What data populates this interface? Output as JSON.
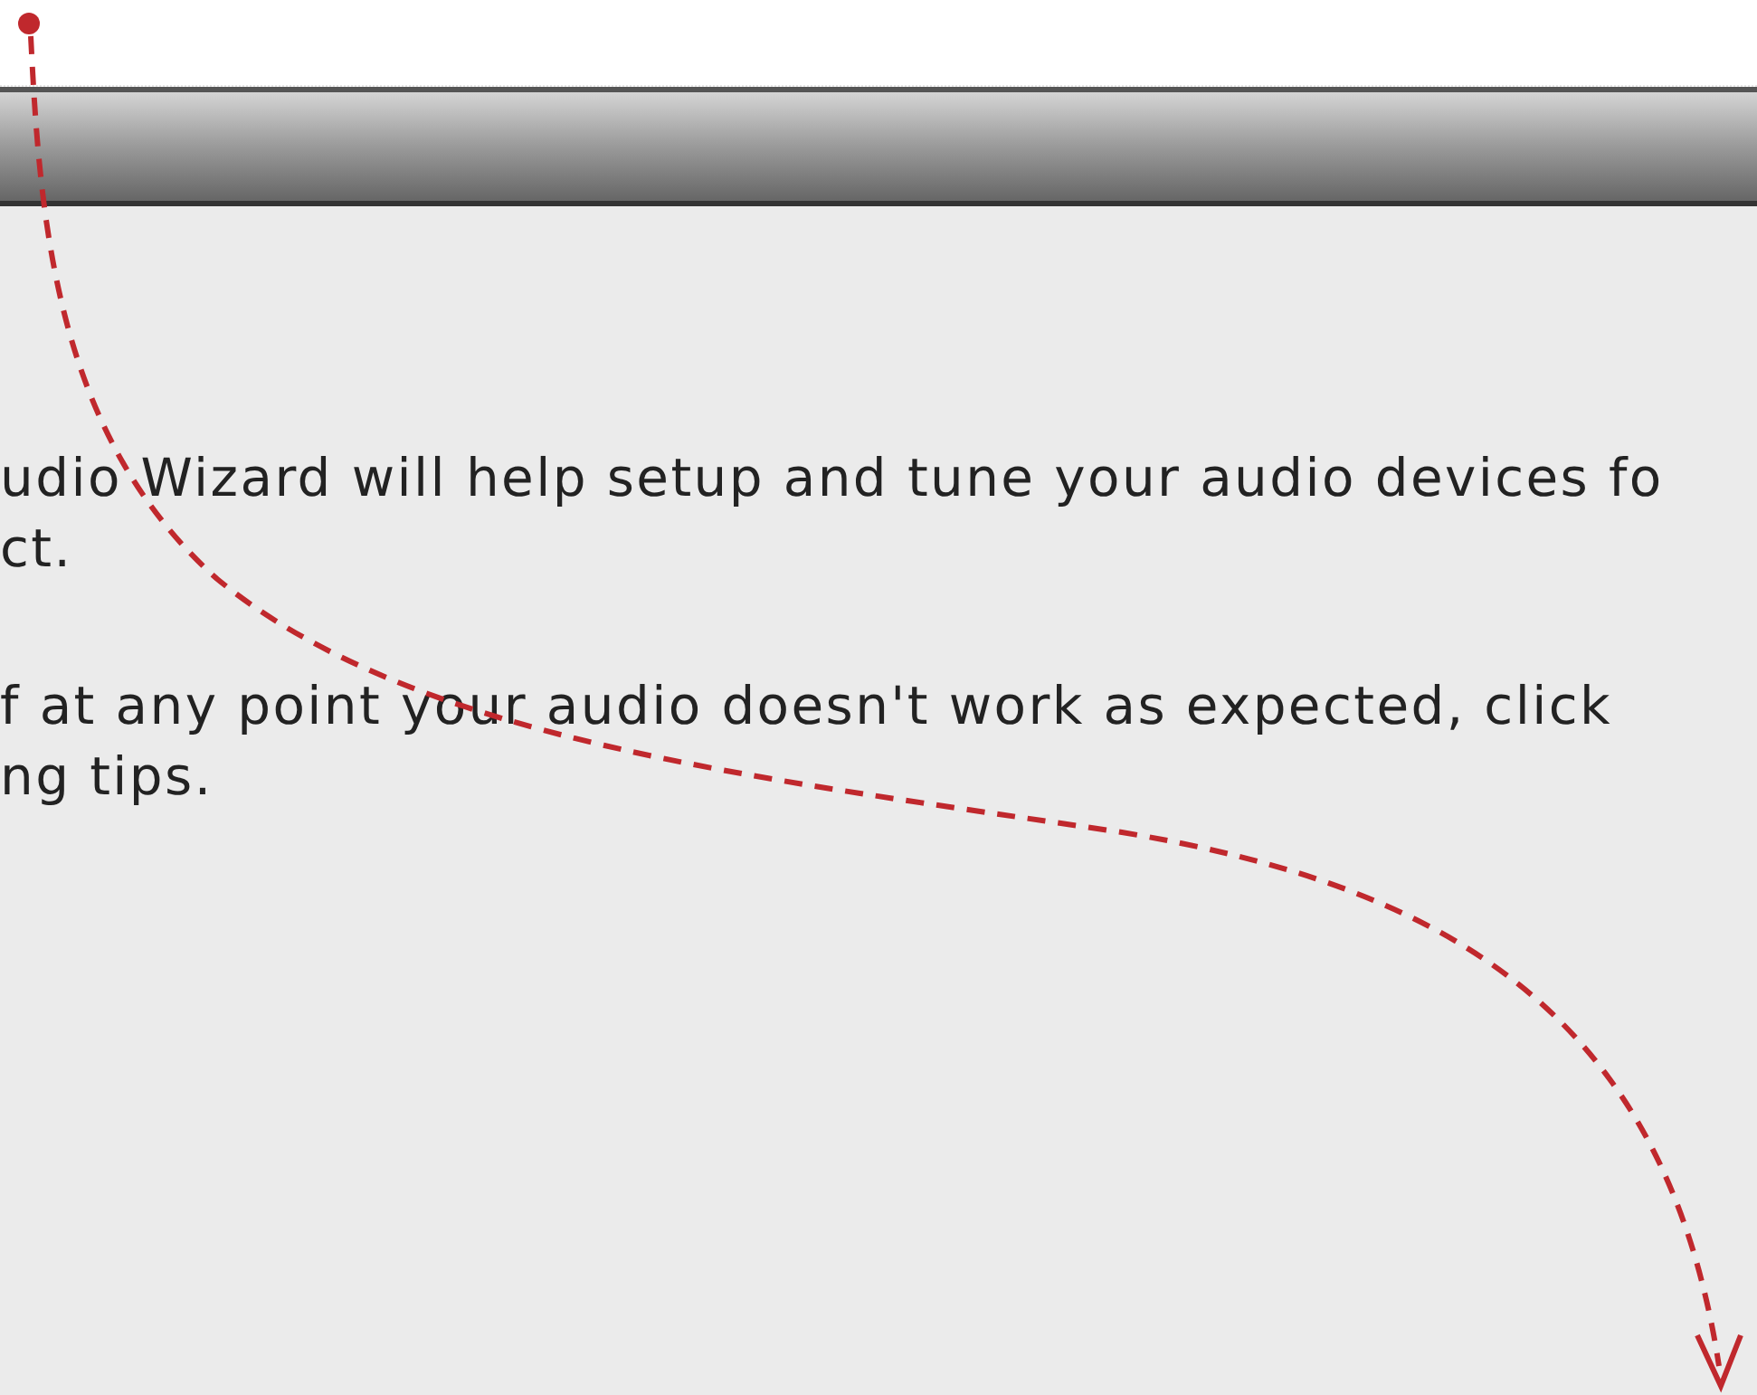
{
  "dialog": {
    "paragraphs": [
      {
        "lines": [
          "udio Wizard will help setup and tune your audio devices fo",
          "ct."
        ]
      },
      {
        "lines": [
          "f at any point your audio doesn't work as expected, click",
          "ng tips."
        ]
      }
    ]
  }
}
